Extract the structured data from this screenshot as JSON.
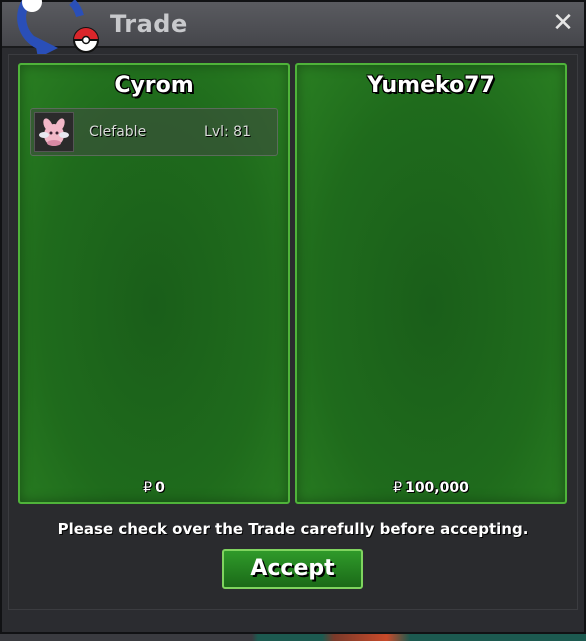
{
  "window": {
    "title": "Trade",
    "close_label": "✕"
  },
  "panels": [
    {
      "player": "Cyrom",
      "items": [
        {
          "pokemon": "Clefable",
          "level": "Lvl: 81"
        }
      ],
      "money_symbol": "₽",
      "money": "0"
    },
    {
      "player": "Yumeko77",
      "items": [],
      "money_symbol": "₽",
      "money": "100,000"
    }
  ],
  "notice": "Please check over the Trade carefully before accepting.",
  "accept_label": "Accept",
  "colors": {
    "panel_green": "#1f6b1c",
    "panel_border": "#4fb33a",
    "accent_blue": "#2a4fb8",
    "pokeball_red": "#d9262b"
  }
}
